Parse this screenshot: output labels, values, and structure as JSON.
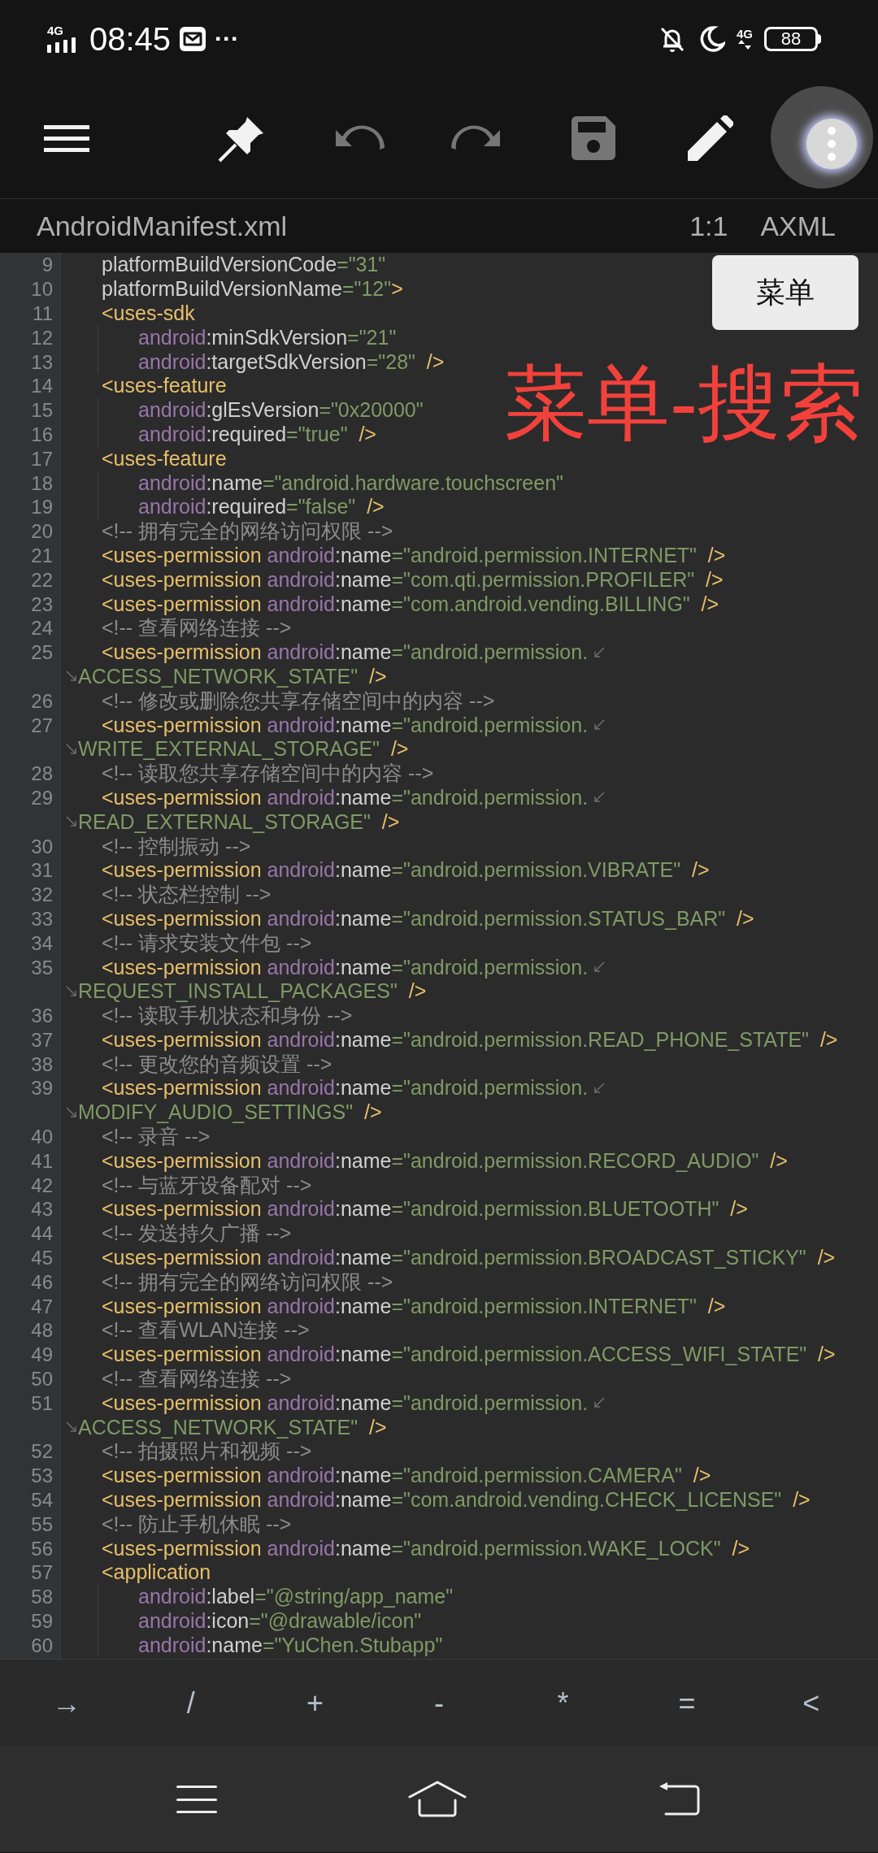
{
  "status_bar": {
    "network": "4G",
    "time": "08:45",
    "more": "···",
    "network_right": "4G",
    "battery": "88"
  },
  "toolbar": [
    {
      "kind": "menu",
      "disabled": false
    },
    {
      "kind": "pin",
      "disabled": false
    },
    {
      "kind": "undo",
      "disabled": true
    },
    {
      "kind": "redo",
      "disabled": true
    },
    {
      "kind": "save",
      "disabled": true
    },
    {
      "kind": "edit",
      "disabled": false
    }
  ],
  "file": {
    "name": "AndroidManifest.xml",
    "position": "1:1",
    "language": "AXML"
  },
  "code_lines": [
    {
      "number": "9",
      "tokens": [
        {
          "kind": "attribute",
          "text": "platformBuildVersionCode"
        },
        {
          "kind": "value",
          "text": "=\"31\""
        }
      ]
    },
    {
      "number": "10",
      "tokens": [
        {
          "kind": "attribute",
          "text": "platformBuildVersionName"
        },
        {
          "kind": "value",
          "text": "=\"12\""
        },
        {
          "kind": "tag",
          "text": ">"
        }
      ]
    },
    {
      "number": "11",
      "tokens": [
        {
          "kind": "tag",
          "text": "<uses-sdk"
        }
      ],
      "children": [
        {
          "number": "12",
          "tokens": [
            {
              "kind": "namespace",
              "text": "android"
            },
            {
              "kind": "attribute",
              "text": ":minSdkVersion"
            },
            {
              "kind": "value",
              "text": "=\"21\""
            }
          ]
        },
        {
          "number": "13",
          "tokens": [
            {
              "kind": "namespace",
              "text": "android"
            },
            {
              "kind": "attribute",
              "text": ":targetSdkVersion"
            },
            {
              "kind": "value",
              "text": "=\"28\""
            },
            {
              "kind": "tag",
              "text": "  />"
            }
          ]
        }
      ]
    },
    {
      "number": "14",
      "tokens": [
        {
          "kind": "tag",
          "text": "<uses-feature"
        }
      ],
      "children": [
        {
          "number": "15",
          "tokens": [
            {
              "kind": "namespace",
              "text": "android"
            },
            {
              "kind": "attribute",
              "text": ":glEsVersion"
            },
            {
              "kind": "value",
              "text": "=\"0x20000\""
            }
          ]
        },
        {
          "number": "16",
          "tokens": [
            {
              "kind": "namespace",
              "text": "android"
            },
            {
              "kind": "attribute",
              "text": ":required"
            },
            {
              "kind": "value",
              "text": "=\"true\""
            },
            {
              "kind": "tag",
              "text": "  />"
            }
          ]
        }
      ]
    },
    {
      "number": "17",
      "tokens": [
        {
          "kind": "tag",
          "text": "<uses-feature"
        }
      ],
      "children": [
        {
          "number": "18",
          "tokens": [
            {
              "kind": "namespace",
              "text": "android"
            },
            {
              "kind": "attribute",
              "text": ":name"
            },
            {
              "kind": "value",
              "text": "=\"android.hardware.touchscreen\""
            }
          ]
        },
        {
          "number": "19",
          "tokens": [
            {
              "kind": "namespace",
              "text": "android"
            },
            {
              "kind": "attribute",
              "text": ":required"
            },
            {
              "kind": "value",
              "text": "=\"false\""
            },
            {
              "kind": "tag",
              "text": "  />"
            }
          ]
        }
      ]
    },
    {
      "number": "20",
      "tokens": [
        {
          "kind": "comment",
          "text": "<!-- 拥有完全的网络访问权限 -->"
        }
      ]
    },
    {
      "number": "21",
      "tokens": [
        {
          "kind": "tag",
          "text": "<uses-permission"
        },
        {
          "kind": "namespace",
          "text": " android"
        },
        {
          "kind": "attribute",
          "text": ":name"
        },
        {
          "kind": "value",
          "text": "=\"android.permission.INTERNET\""
        },
        {
          "kind": "tag",
          "text": "  />"
        }
      ]
    },
    {
      "number": "22",
      "tokens": [
        {
          "kind": "tag",
          "text": "<uses-permission"
        },
        {
          "kind": "namespace",
          "text": " android"
        },
        {
          "kind": "attribute",
          "text": ":name"
        },
        {
          "kind": "value",
          "text": "=\"com.qti.permission.PROFILER\""
        },
        {
          "kind": "tag",
          "text": "  />"
        }
      ]
    },
    {
      "number": "23",
      "tokens": [
        {
          "kind": "tag",
          "text": "<uses-permission"
        },
        {
          "kind": "namespace",
          "text": " android"
        },
        {
          "kind": "attribute",
          "text": ":name"
        },
        {
          "kind": "value",
          "text": "=\"com.android.vending.BILLING\""
        },
        {
          "kind": "tag",
          "text": "  />"
        }
      ]
    },
    {
      "number": "24",
      "tokens": [
        {
          "kind": "comment",
          "text": "<!-- 查看网络连接 -->"
        }
      ]
    },
    {
      "number": "25",
      "tokens": [
        {
          "kind": "tag",
          "text": "<uses-permission"
        },
        {
          "kind": "namespace",
          "text": " android"
        },
        {
          "kind": "attribute",
          "text": ":name"
        },
        {
          "kind": "value",
          "text": "=\"android.permission."
        }
      ],
      "continuation": [
        {
          "kind": "value",
          "text": "ACCESS_NETWORK_STATE\""
        },
        {
          "kind": "tag",
          "text": "  />"
        }
      ]
    },
    {
      "number": "26",
      "tokens": [
        {
          "kind": "comment",
          "text": "<!-- 修改或删除您共享存储空间中的内容 -->"
        }
      ]
    },
    {
      "number": "27",
      "tokens": [
        {
          "kind": "tag",
          "text": "<uses-permission"
        },
        {
          "kind": "namespace",
          "text": " android"
        },
        {
          "kind": "attribute",
          "text": ":name"
        },
        {
          "kind": "value",
          "text": "=\"android.permission."
        }
      ],
      "continuation": [
        {
          "kind": "value",
          "text": "WRITE_EXTERNAL_STORAGE\""
        },
        {
          "kind": "tag",
          "text": "  />"
        }
      ]
    },
    {
      "number": "28",
      "tokens": [
        {
          "kind": "comment",
          "text": "<!-- 读取您共享存储空间中的内容 -->"
        }
      ]
    },
    {
      "number": "29",
      "tokens": [
        {
          "kind": "tag",
          "text": "<uses-permission"
        },
        {
          "kind": "namespace",
          "text": " android"
        },
        {
          "kind": "attribute",
          "text": ":name"
        },
        {
          "kind": "value",
          "text": "=\"android.permission."
        }
      ],
      "continuation": [
        {
          "kind": "value",
          "text": "READ_EXTERNAL_STORAGE\""
        },
        {
          "kind": "tag",
          "text": "  />"
        }
      ]
    },
    {
      "number": "30",
      "tokens": [
        {
          "kind": "comment",
          "text": "<!-- 控制振动 -->"
        }
      ]
    },
    {
      "number": "31",
      "tokens": [
        {
          "kind": "tag",
          "text": "<uses-permission"
        },
        {
          "kind": "namespace",
          "text": " android"
        },
        {
          "kind": "attribute",
          "text": ":name"
        },
        {
          "kind": "value",
          "text": "=\"android.permission.VIBRATE\""
        },
        {
          "kind": "tag",
          "text": "  />"
        }
      ]
    },
    {
      "number": "32",
      "tokens": [
        {
          "kind": "comment",
          "text": "<!-- 状态栏控制 -->"
        }
      ]
    },
    {
      "number": "33",
      "tokens": [
        {
          "kind": "tag",
          "text": "<uses-permission"
        },
        {
          "kind": "namespace",
          "text": " android"
        },
        {
          "kind": "attribute",
          "text": ":name"
        },
        {
          "kind": "value",
          "text": "=\"android.permission.STATUS_BAR\""
        },
        {
          "kind": "tag",
          "text": "  />"
        }
      ]
    },
    {
      "number": "34",
      "tokens": [
        {
          "kind": "comment",
          "text": "<!-- 请求安装文件包 -->"
        }
      ]
    },
    {
      "number": "35",
      "tokens": [
        {
          "kind": "tag",
          "text": "<uses-permission"
        },
        {
          "kind": "namespace",
          "text": " android"
        },
        {
          "kind": "attribute",
          "text": ":name"
        },
        {
          "kind": "value",
          "text": "=\"android.permission."
        }
      ],
      "continuation": [
        {
          "kind": "value",
          "text": "REQUEST_INSTALL_PACKAGES\""
        },
        {
          "kind": "tag",
          "text": "  />"
        }
      ]
    },
    {
      "number": "36",
      "tokens": [
        {
          "kind": "comment",
          "text": "<!-- 读取手机状态和身份 -->"
        }
      ]
    },
    {
      "number": "37",
      "tokens": [
        {
          "kind": "tag",
          "text": "<uses-permission"
        },
        {
          "kind": "namespace",
          "text": " android"
        },
        {
          "kind": "attribute",
          "text": ":name"
        },
        {
          "kind": "value",
          "text": "=\"android.permission.READ_PHONE_STATE\""
        },
        {
          "kind": "tag",
          "text": "  />"
        }
      ]
    },
    {
      "number": "38",
      "tokens": [
        {
          "kind": "comment",
          "text": "<!-- 更改您的音频设置 -->"
        }
      ]
    },
    {
      "number": "39",
      "tokens": [
        {
          "kind": "tag",
          "text": "<uses-permission"
        },
        {
          "kind": "namespace",
          "text": " android"
        },
        {
          "kind": "attribute",
          "text": ":name"
        },
        {
          "kind": "value",
          "text": "=\"android.permission."
        }
      ],
      "continuation": [
        {
          "kind": "value",
          "text": "MODIFY_AUDIO_SETTINGS\""
        },
        {
          "kind": "tag",
          "text": "  />"
        }
      ]
    },
    {
      "number": "40",
      "tokens": [
        {
          "kind": "comment",
          "text": "<!-- 录音 -->"
        }
      ]
    },
    {
      "number": "41",
      "tokens": [
        {
          "kind": "tag",
          "text": "<uses-permission"
        },
        {
          "kind": "namespace",
          "text": " android"
        },
        {
          "kind": "attribute",
          "text": ":name"
        },
        {
          "kind": "value",
          "text": "=\"android.permission.RECORD_AUDIO\""
        },
        {
          "kind": "tag",
          "text": "  />"
        }
      ]
    },
    {
      "number": "42",
      "tokens": [
        {
          "kind": "comment",
          "text": "<!-- 与蓝牙设备配对 -->"
        }
      ]
    },
    {
      "number": "43",
      "tokens": [
        {
          "kind": "tag",
          "text": "<uses-permission"
        },
        {
          "kind": "namespace",
          "text": " android"
        },
        {
          "kind": "attribute",
          "text": ":name"
        },
        {
          "kind": "value",
          "text": "=\"android.permission.BLUETOOTH\""
        },
        {
          "kind": "tag",
          "text": "  />"
        }
      ]
    },
    {
      "number": "44",
      "tokens": [
        {
          "kind": "comment",
          "text": "<!-- 发送持久广播 -->"
        }
      ]
    },
    {
      "number": "45",
      "tokens": [
        {
          "kind": "tag",
          "text": "<uses-permission"
        },
        {
          "kind": "namespace",
          "text": " android"
        },
        {
          "kind": "attribute",
          "text": ":name"
        },
        {
          "kind": "value",
          "text": "=\"android.permission.BROADCAST_STICKY\""
        },
        {
          "kind": "tag",
          "text": "  />"
        }
      ]
    },
    {
      "number": "46",
      "tokens": [
        {
          "kind": "comment",
          "text": "<!-- 拥有完全的网络访问权限 -->"
        }
      ]
    },
    {
      "number": "47",
      "tokens": [
        {
          "kind": "tag",
          "text": "<uses-permission"
        },
        {
          "kind": "namespace",
          "text": " android"
        },
        {
          "kind": "attribute",
          "text": ":name"
        },
        {
          "kind": "value",
          "text": "=\"android.permission.INTERNET\""
        },
        {
          "kind": "tag",
          "text": "  />"
        }
      ]
    },
    {
      "number": "48",
      "tokens": [
        {
          "kind": "comment",
          "text": "<!-- 查看WLAN连接 -->"
        }
      ]
    },
    {
      "number": "49",
      "tokens": [
        {
          "kind": "tag",
          "text": "<uses-permission"
        },
        {
          "kind": "namespace",
          "text": " android"
        },
        {
          "kind": "attribute",
          "text": ":name"
        },
        {
          "kind": "value",
          "text": "=\"android.permission.ACCESS_WIFI_STATE\""
        },
        {
          "kind": "tag",
          "text": "  />"
        }
      ]
    },
    {
      "number": "50",
      "tokens": [
        {
          "kind": "comment",
          "text": "<!-- 查看网络连接 -->"
        }
      ]
    },
    {
      "number": "51",
      "tokens": [
        {
          "kind": "tag",
          "text": "<uses-permission"
        },
        {
          "kind": "namespace",
          "text": " android"
        },
        {
          "kind": "attribute",
          "text": ":name"
        },
        {
          "kind": "value",
          "text": "=\"android.permission."
        }
      ],
      "continuation": [
        {
          "kind": "value",
          "text": "ACCESS_NETWORK_STATE\""
        },
        {
          "kind": "tag",
          "text": "  />"
        }
      ]
    },
    {
      "number": "52",
      "tokens": [
        {
          "kind": "comment",
          "text": "<!-- 拍摄照片和视频 -->"
        }
      ]
    },
    {
      "number": "53",
      "tokens": [
        {
          "kind": "tag",
          "text": "<uses-permission"
        },
        {
          "kind": "namespace",
          "text": " android"
        },
        {
          "kind": "attribute",
          "text": ":name"
        },
        {
          "kind": "value",
          "text": "=\"android.permission.CAMERA\""
        },
        {
          "kind": "tag",
          "text": "  />"
        }
      ]
    },
    {
      "number": "54",
      "tokens": [
        {
          "kind": "tag",
          "text": "<uses-permission"
        },
        {
          "kind": "namespace",
          "text": " android"
        },
        {
          "kind": "attribute",
          "text": ":name"
        },
        {
          "kind": "value",
          "text": "=\"com.android.vending.CHECK_LICENSE\""
        },
        {
          "kind": "tag",
          "text": "  />"
        }
      ]
    },
    {
      "number": "55",
      "tokens": [
        {
          "kind": "comment",
          "text": "<!-- 防止手机休眠 -->"
        }
      ]
    },
    {
      "number": "56",
      "tokens": [
        {
          "kind": "tag",
          "text": "<uses-permission"
        },
        {
          "kind": "namespace",
          "text": " android"
        },
        {
          "kind": "attribute",
          "text": ":name"
        },
        {
          "kind": "value",
          "text": "=\"android.permission.WAKE_LOCK\""
        },
        {
          "kind": "tag",
          "text": "  />"
        }
      ]
    },
    {
      "number": "57",
      "tokens": [
        {
          "kind": "tag",
          "text": "<application"
        }
      ],
      "children": [
        {
          "number": "58",
          "tokens": [
            {
              "kind": "namespace",
              "text": "android"
            },
            {
              "kind": "attribute",
              "text": ":label"
            },
            {
              "kind": "value",
              "text": "=\"@string/app_name\""
            }
          ]
        },
        {
          "number": "59",
          "tokens": [
            {
              "kind": "namespace",
              "text": "android"
            },
            {
              "kind": "attribute",
              "text": ":icon"
            },
            {
              "kind": "value",
              "text": "=\"@drawable/icon\""
            }
          ]
        },
        {
          "number": "60",
          "tokens": [
            {
              "kind": "namespace",
              "text": "android"
            },
            {
              "kind": "attribute",
              "text": ":name"
            },
            {
              "kind": "value",
              "text": "=\"YuChen.Stubapp\""
            }
          ]
        }
      ]
    }
  ],
  "overlay": {
    "menu_button": "菜单",
    "annotation": "菜单-搜索"
  },
  "symbol_keys": [
    "→",
    "/",
    "+",
    "-",
    "*",
    "=",
    "<"
  ]
}
